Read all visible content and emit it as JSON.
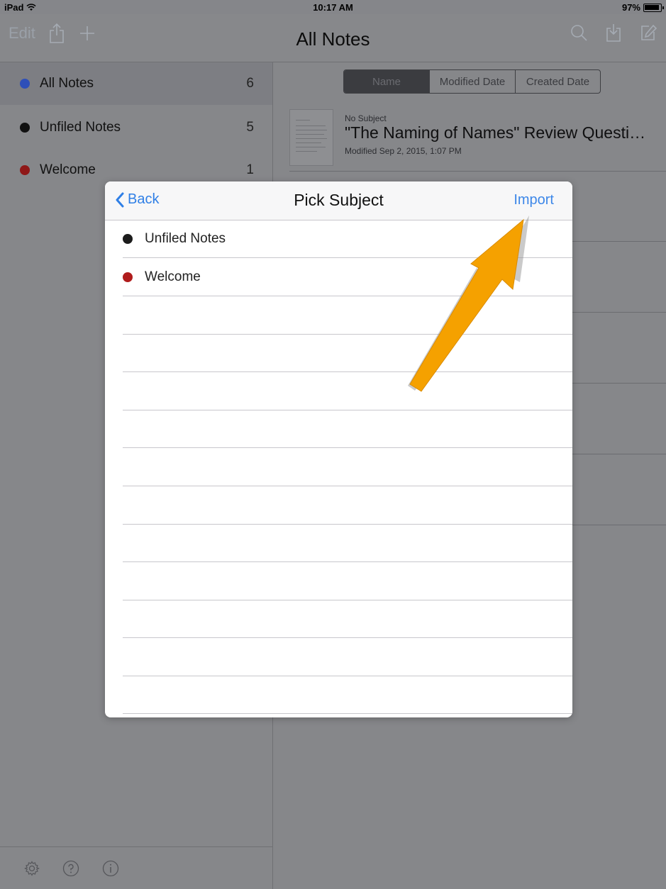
{
  "status_bar": {
    "device": "iPad",
    "time": "10:17 AM",
    "battery": "97%"
  },
  "nav": {
    "edit_label": "Edit",
    "title": "All Notes",
    "left_icons": [
      "share-icon",
      "plus-icon"
    ],
    "right_icons": [
      "search-icon",
      "import-icon",
      "compose-icon"
    ]
  },
  "sidebar": {
    "items": [
      {
        "label": "All Notes",
        "count": "6",
        "color": "#2e4fb8",
        "active": true
      },
      {
        "label": "Unfiled Notes",
        "count": "5",
        "color": "#111111",
        "active": false
      },
      {
        "label": "Welcome",
        "count": "1",
        "color": "#8f1818",
        "active": false
      }
    ],
    "footer_icons": [
      "gear-icon",
      "help-icon",
      "info-icon"
    ]
  },
  "sort": {
    "options": [
      "Name",
      "Modified Date",
      "Created Date"
    ],
    "selected": "Name"
  },
  "notes": [
    {
      "subject": "No Subject",
      "title": "\"The Naming of Names\" Review Questi…",
      "modified": "Modified Sep 2, 2015, 1:07 PM"
    }
  ],
  "popover": {
    "back_label": "Back",
    "title": "Pick Subject",
    "import_label": "Import",
    "subjects": [
      {
        "label": "Unfiled Notes",
        "color": "#1c1c1c"
      },
      {
        "label": "Welcome",
        "color": "#b01c1c"
      }
    ]
  },
  "colors": {
    "accent": "#2f7fe6",
    "annotation_arrow": "#f5a100"
  }
}
